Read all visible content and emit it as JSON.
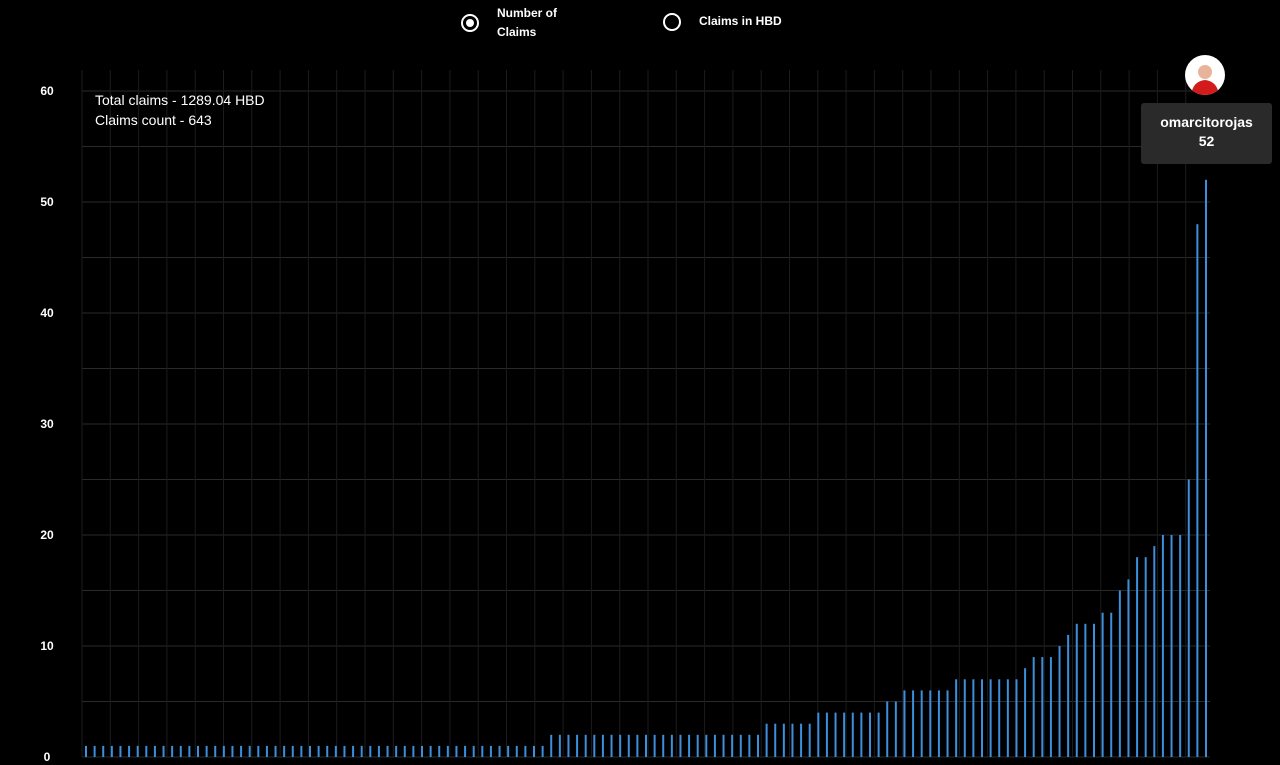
{
  "toggle": {
    "options": [
      {
        "label": "Number of\nClaims",
        "selected": true
      },
      {
        "label": "Claims in HBD",
        "selected": false
      }
    ]
  },
  "summary": {
    "total": "Total claims - 1289.04 HBD",
    "count": "Claims count - 643"
  },
  "tooltip": {
    "name": "omarcitorojas",
    "value": "52",
    "avatar_colors": {
      "shirt": "#d31b1b",
      "face": "#e8b39a",
      "bg": "#ffffff"
    }
  },
  "chart_data": {
    "type": "bar",
    "ylim": [
      0,
      60
    ],
    "yticks": [
      "0",
      "10",
      "20",
      "30",
      "40",
      "50",
      "60"
    ],
    "grid": true,
    "bar_color": "#3d8fdb",
    "grid_color": "#2a2a2a",
    "values": [
      1,
      1,
      1,
      1,
      1,
      1,
      1,
      1,
      1,
      1,
      1,
      1,
      1,
      1,
      1,
      1,
      1,
      1,
      1,
      1,
      1,
      1,
      1,
      1,
      1,
      1,
      1,
      1,
      1,
      1,
      1,
      1,
      1,
      1,
      1,
      1,
      1,
      1,
      1,
      1,
      1,
      1,
      1,
      1,
      1,
      1,
      1,
      1,
      1,
      1,
      1,
      1,
      1,
      1,
      2,
      2,
      2,
      2,
      2,
      2,
      2,
      2,
      2,
      2,
      2,
      2,
      2,
      2,
      2,
      2,
      2,
      2,
      2,
      2,
      2,
      2,
      2,
      2,
      2,
      3,
      3,
      3,
      3,
      3,
      3,
      4,
      4,
      4,
      4,
      4,
      4,
      4,
      4,
      5,
      5,
      6,
      6,
      6,
      6,
      6,
      6,
      7,
      7,
      7,
      7,
      7,
      7,
      7,
      7,
      8,
      9,
      9,
      9,
      10,
      11,
      12,
      12,
      12,
      13,
      13,
      15,
      16,
      18,
      18,
      19,
      20,
      20,
      20,
      25,
      48,
      52
    ]
  }
}
